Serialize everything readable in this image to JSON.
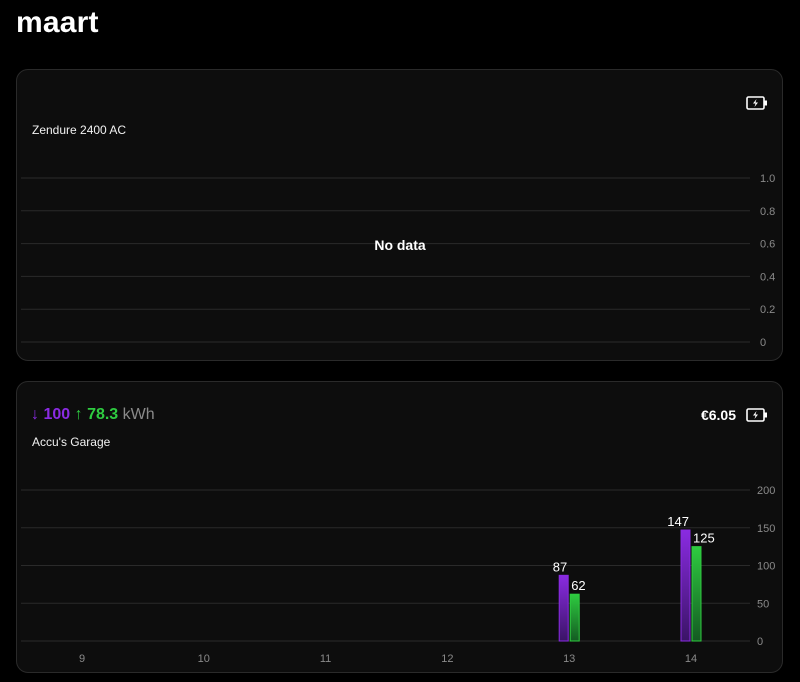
{
  "page": {
    "title": "maart"
  },
  "cards": [
    {
      "title": "Zendure 2400 AC",
      "icon": "battery-charging-icon",
      "chart": {
        "no_data_text": "No data",
        "y_ticks": [
          "1.0",
          "0.8",
          "0.6",
          "0.4",
          "0.2",
          "0"
        ]
      }
    },
    {
      "title": "Accu's Garage",
      "icon": "battery-charging-icon",
      "summary": {
        "in_arrow": "↓",
        "in_value": "100",
        "out_arrow": "↑",
        "out_value": "78.3",
        "unit": "kWh"
      },
      "cost": "€6.05"
    }
  ],
  "chart_data": {
    "type": "bar",
    "categories": [
      "9",
      "10",
      "11",
      "12",
      "13",
      "14"
    ],
    "series": [
      {
        "values": [
          0,
          0,
          0,
          0,
          87,
          147
        ],
        "color": "#8a2be2"
      },
      {
        "values": [
          0,
          0,
          0,
          0,
          62,
          125
        ],
        "color": "#2ecc40"
      }
    ],
    "ylim": [
      0,
      200
    ],
    "y_ticks": [
      200,
      150,
      100,
      50,
      0
    ],
    "grid": true
  }
}
